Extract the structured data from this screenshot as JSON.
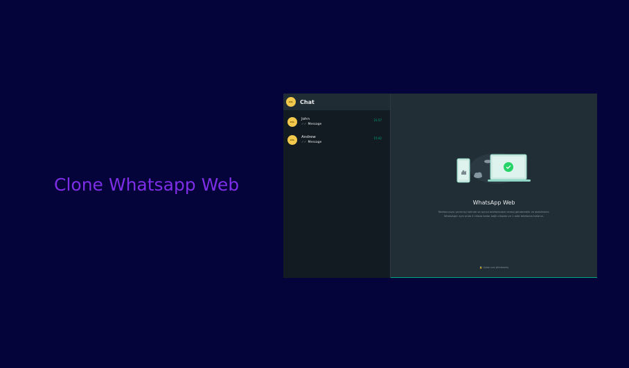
{
  "hero": {
    "title": "Clone Whatsapp Web"
  },
  "colors": {
    "background": "#04043a",
    "hero_text": "#7d2ee6",
    "accent": "#00a884",
    "sidebar_bg": "#111b21",
    "header_bg": "#202c33",
    "main_bg": "#222e35",
    "avatar": "#f2c94c"
  },
  "app": {
    "sidebar": {
      "title": "Chat",
      "profile_avatar_label": "ZAL",
      "chats": [
        {
          "name": "John",
          "preview": "Message",
          "time": "21:57",
          "avatar_label": "ZAL"
        },
        {
          "name": "Andrew",
          "preview": "Message",
          "time": "15:42",
          "avatar_label": "ZAL"
        }
      ]
    },
    "main": {
      "title": "WhatsApp Web",
      "description_line1": "Telefonunuzu çevrimiçi halinde ve ayrıca telefonlardan mesaj gönderebilir ve alabilirsiniz.",
      "description_line2": "WhatsApp'ı aynı anda 4 cihaza kadar bağlı cihazda ve 1 adet telefonda kullanın.",
      "encryption_note": "🔒 Uçtan uca şifrelenmiş"
    }
  }
}
